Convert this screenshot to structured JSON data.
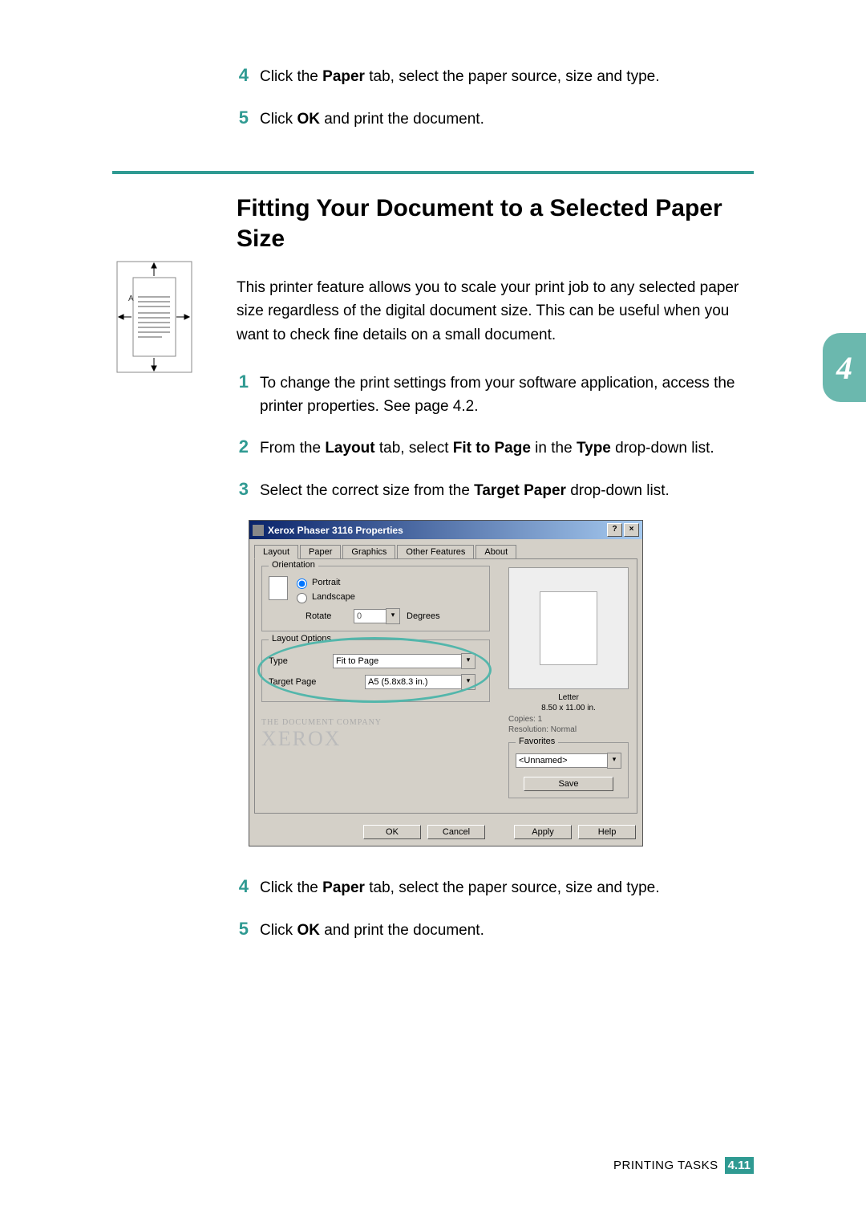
{
  "steps_top": [
    {
      "num": "4",
      "html": "Click the <b>Paper</b> tab, select the paper source, size and type."
    },
    {
      "num": "5",
      "html": "Click <b>OK</b> and print the document."
    }
  ],
  "heading": "Fitting Your Document to a Selected Paper Size",
  "intro": "This printer feature allows you to scale your print job to any selected paper size regardless of the digital document size. This can be useful when you want to check fine details on a small document.",
  "steps_mid": [
    {
      "num": "1",
      "html": "To change the print settings from your software application, access the printer properties. See page 4.2."
    },
    {
      "num": "2",
      "html": "From the <b>Layout</b> tab, select <b>Fit to Page</b> in the <b>Type</b> drop-down list."
    },
    {
      "num": "3",
      "html": "Select the correct size from the <b>Target Paper</b> drop-down list."
    }
  ],
  "dialog": {
    "title": "Xerox Phaser 3116 Properties",
    "tabs": [
      "Layout",
      "Paper",
      "Graphics",
      "Other Features",
      "About"
    ],
    "active_tab": "Layout",
    "orientation": {
      "legend": "Orientation",
      "portrait": "Portrait",
      "landscape": "Landscape",
      "rotate_label": "Rotate",
      "rotate_value": "0",
      "rotate_unit": "Degrees"
    },
    "layout_options": {
      "legend": "Layout Options",
      "type_label": "Type",
      "type_value": "Fit to Page",
      "target_label": "Target Page",
      "target_value": "A5 (5.8x8.3 in.)"
    },
    "preview": {
      "paper_name": "Letter",
      "paper_dim": "8.50 x 11.00 in.",
      "copies": "Copies: 1",
      "resolution": "Resolution: Normal"
    },
    "favorites": {
      "legend": "Favorites",
      "value": "<Unnamed>",
      "save": "Save"
    },
    "brand_small": "THE DOCUMENT COMPANY",
    "brand_big": "XEROX",
    "buttons": {
      "ok": "OK",
      "cancel": "Cancel",
      "apply": "Apply",
      "help": "Help"
    }
  },
  "steps_bottom": [
    {
      "num": "4",
      "html": "Click the <b>Paper</b> tab, select the paper source, size and type."
    },
    {
      "num": "5",
      "html": "Click <b>OK</b> and print the document."
    }
  ],
  "chapter_tab": "4",
  "footer": {
    "label": "PRINTING TASKS",
    "chapter": "4.",
    "page": "11"
  }
}
